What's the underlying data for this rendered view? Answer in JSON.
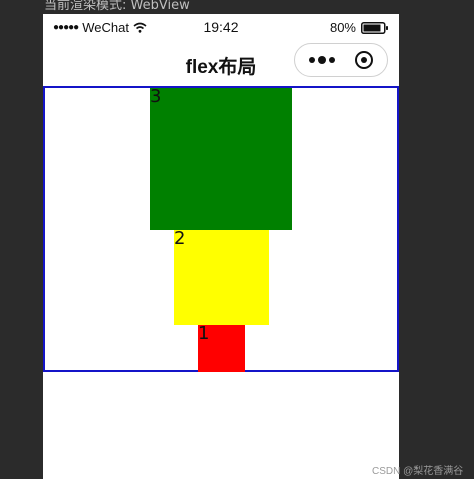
{
  "devtools": {
    "render_mode_label": "当前渲染模式: WebView"
  },
  "status_bar": {
    "carrier": "WeChat",
    "time": "19:42",
    "battery": "80%"
  },
  "nav_bar": {
    "title": "flex布局"
  },
  "flex_items": [
    {
      "label": "3",
      "color": "#008000"
    },
    {
      "label": "2",
      "color": "#ffff00"
    },
    {
      "label": "1",
      "color": "#ff0000"
    }
  ],
  "container": {
    "border_color": "#1414c8"
  },
  "watermark": "CSDN @梨花香满谷"
}
